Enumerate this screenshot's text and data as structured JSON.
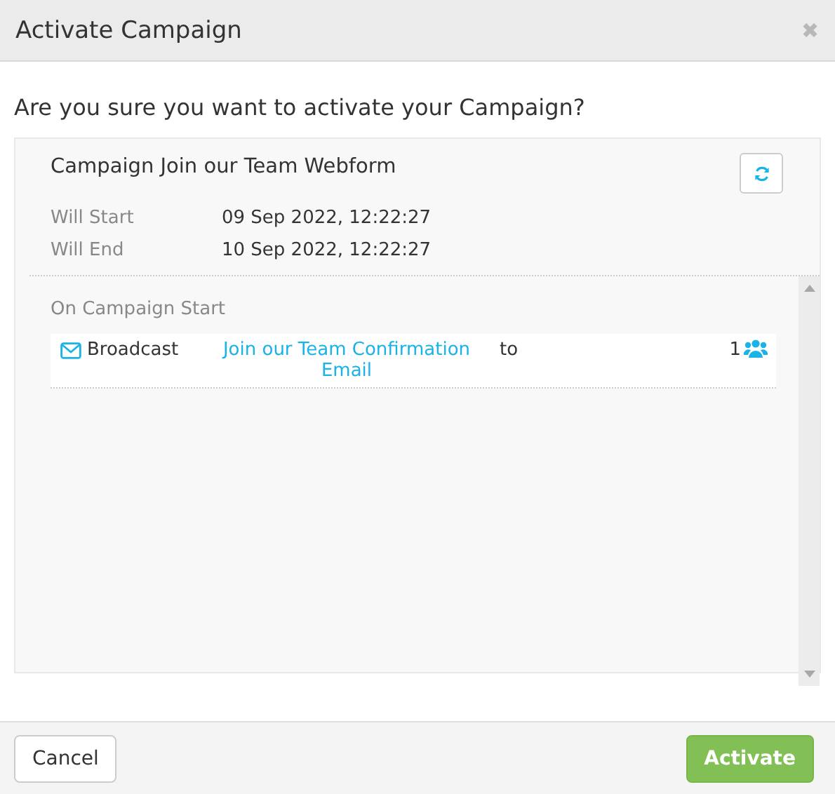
{
  "window": {
    "title": "Activate Campaign",
    "close": "✖"
  },
  "question": "Are you sure you want to activate your Campaign?",
  "campaign": {
    "title": "Campaign Join our Team Webform",
    "fields": [
      {
        "label": "Will Start",
        "value": "09 Sep 2022, 12:22:27"
      },
      {
        "label": "Will End",
        "value": "10 Sep 2022, 12:22:27"
      }
    ]
  },
  "section": {
    "title": "On Campaign Start",
    "actions": [
      {
        "kind": "email",
        "type": "Broadcast",
        "link": "Join our Team Confirmation Email",
        "to": "to",
        "count": "1"
      }
    ]
  },
  "buttons": [
    {
      "label": "Cancel",
      "kind": "default"
    },
    {
      "label": "Activate",
      "kind": "primary"
    }
  ]
}
